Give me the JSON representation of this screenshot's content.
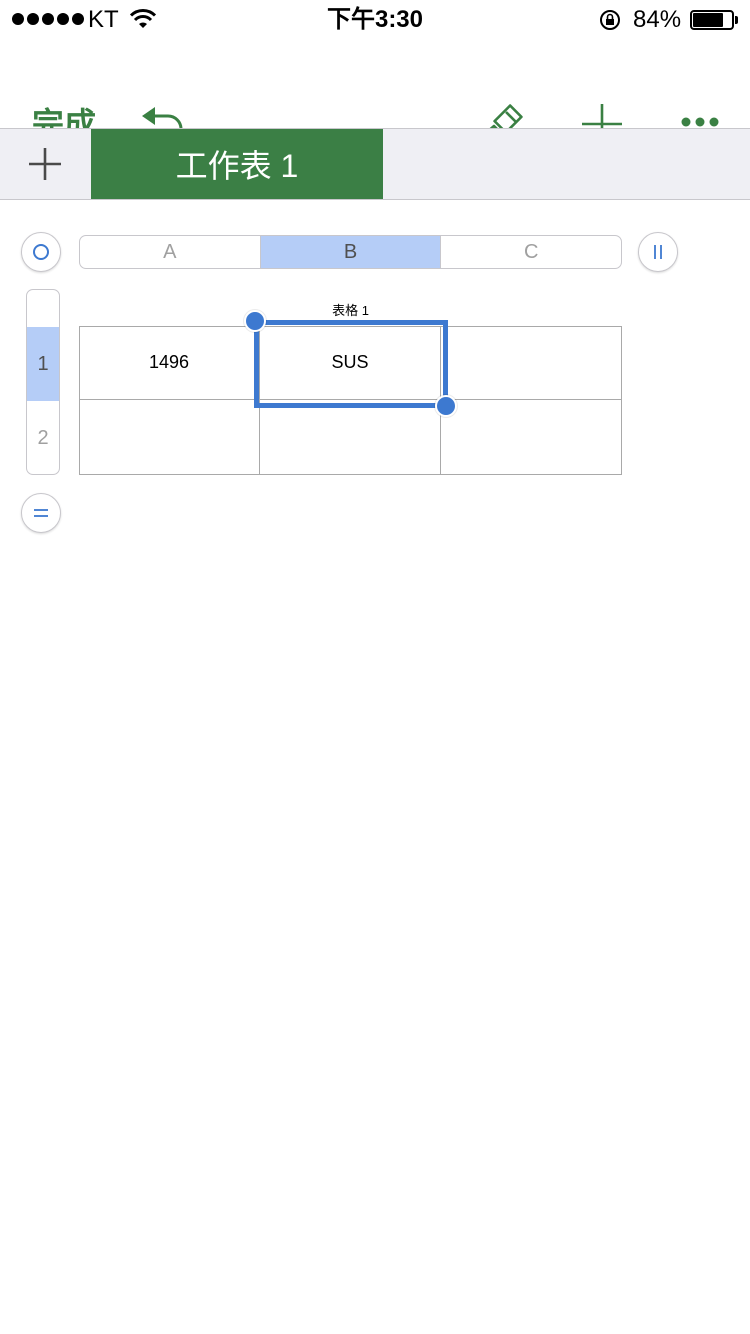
{
  "status_bar": {
    "carrier": "KT",
    "time": "下午3:30",
    "battery_percent": "84%",
    "battery_level": 0.84,
    "icons": [
      "signal-dots",
      "wifi-icon",
      "rotation-lock-icon",
      "battery-icon"
    ]
  },
  "toolbar": {
    "done_label": "完成",
    "icons": [
      "undo-icon",
      "paintbrush-icon",
      "plus-icon",
      "more-icon"
    ],
    "accent_color": "#3a8043"
  },
  "sheets": {
    "add_icon": "plus-icon",
    "active_tab_label": "工作表 1",
    "active_tab_color": "#3b7f45"
  },
  "table": {
    "title": "表格 1",
    "columns": [
      "A",
      "B",
      "C"
    ],
    "rows": [
      "1",
      "2"
    ],
    "cells": [
      [
        "1496",
        "SUS",
        ""
      ],
      [
        "",
        "",
        ""
      ]
    ],
    "selected_column": "B",
    "selected_row": "1",
    "selected_cell": "B1",
    "selection_color": "#3d79d0",
    "header_highlight_color": "#b5cdf7"
  }
}
